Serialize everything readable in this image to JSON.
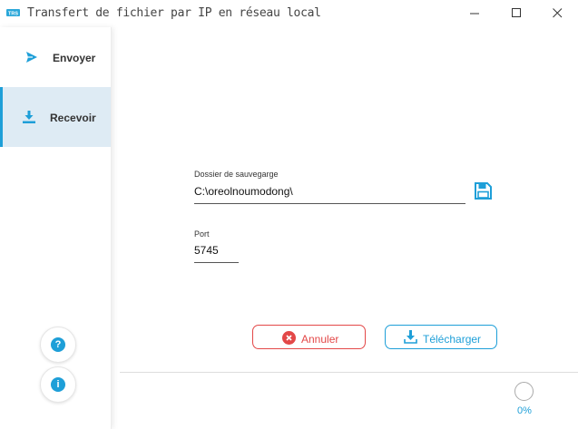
{
  "window": {
    "title": "Transfert de fichier par IP en réseau local",
    "app_icon_text": "TRS"
  },
  "sidebar": {
    "items": [
      {
        "label": "Envoyer",
        "icon": "send-icon",
        "active": false
      },
      {
        "label": "Recevoir",
        "icon": "download-icon",
        "active": true
      }
    ],
    "help_icon": "?",
    "info_icon": "i"
  },
  "form": {
    "folder_label": "Dossier de sauvegarge",
    "folder_value": "C:\\oreolnoumodong\\",
    "port_label": "Port",
    "port_value": "5745"
  },
  "buttons": {
    "cancel_label": "Annuler",
    "download_label": "Télécharger"
  },
  "status": {
    "progress": 0,
    "progress_text": "0%"
  },
  "colors": {
    "accent": "#1e9fd8",
    "danger": "#e34848",
    "active_bg": "#deebf4"
  }
}
